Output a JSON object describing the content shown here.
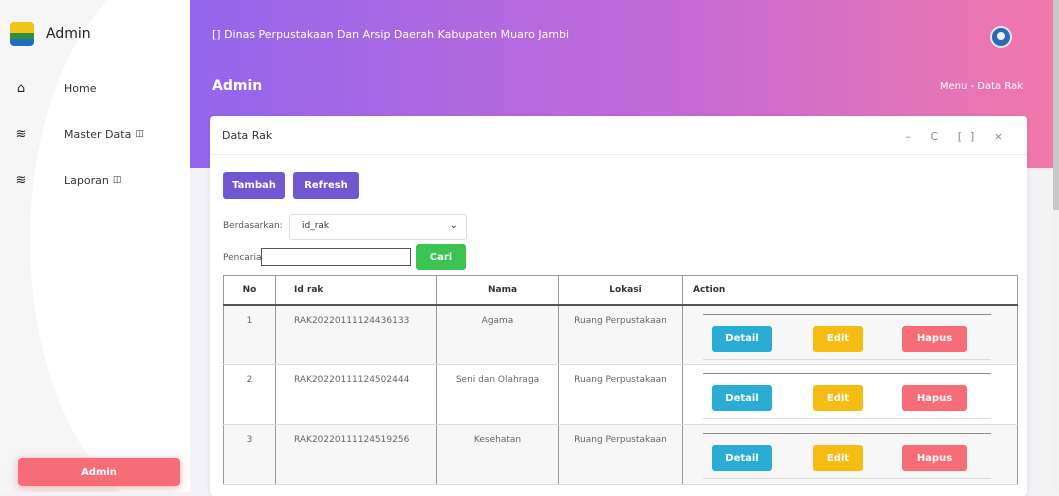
{
  "sidebar": {
    "brand": "Admin",
    "items": [
      {
        "icon": "home-icon",
        "label": "Home",
        "ext": ""
      },
      {
        "icon": "layers-icon",
        "label": "Master Data",
        "ext": "◫"
      },
      {
        "icon": "layers-icon",
        "label": "Laporan",
        "ext": "◫"
      }
    ],
    "user_button": "Admin"
  },
  "topbar": {
    "title": "[] Dinas Perpustakaan Dan Arsip Daerah Kabupaten Muaro Jambi"
  },
  "page": {
    "title": "Admin",
    "breadcrumb": "Menu - Data Rak"
  },
  "card": {
    "title": "Data Rak",
    "tools": "– C [] ×",
    "add_button": "Tambah",
    "refresh_button": "Refresh",
    "filter_label": "Berdasarkan:",
    "filter_value": "id_rak",
    "search_label": "Pencarian    :",
    "search_value": "",
    "search_button": "Cari"
  },
  "table": {
    "headers": [
      "No",
      "Id rak",
      "Nama",
      "Lokasi",
      "Action"
    ],
    "rows": [
      {
        "no": "1",
        "id": "RAK20220111124436133",
        "nama": "Agama",
        "lokasi": "Ruang Perpustakaan"
      },
      {
        "no": "2",
        "id": "RAK20220111124502444",
        "nama": "Seni dan Olahraga",
        "lokasi": "Ruang Perpustakaan"
      },
      {
        "no": "3",
        "id": "RAK20220111124519256",
        "nama": "Kesehatan",
        "lokasi": "Ruang Perpustakaan"
      }
    ],
    "actions": {
      "detail": "Detail",
      "edit": "Edit",
      "delete": "Hapus"
    }
  },
  "colors": {
    "accent": "#9466ec",
    "pink": "#f278a9",
    "info": "#2bacd4",
    "warning": "#f5bd13",
    "danger": "#f66d78",
    "success": "#3bc452"
  }
}
